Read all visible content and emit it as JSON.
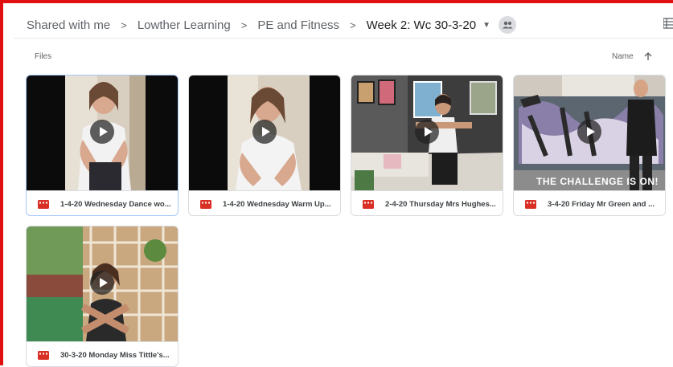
{
  "breadcrumb": {
    "items": [
      "Shared with me",
      "Lowther Learning",
      "PE and Fitness"
    ],
    "current": "Week 2: Wc 30-3-20"
  },
  "icons": {
    "separator": "chevron-right-icon",
    "dropdown": "caret-down-icon",
    "shared_folder": "people-icon",
    "view_toggle": "list-view-icon",
    "sort_direction": "arrow-up-icon",
    "video_file": "video-file-icon",
    "play": "play-icon"
  },
  "files_section": {
    "label": "Files",
    "sort_label": "Name"
  },
  "files": [
    {
      "name": "1-4-20 Wednesday Dance wo...",
      "selected": true
    },
    {
      "name": "1-4-20 Wednesday Warm Up..."
    },
    {
      "name": "2-4-20 Thursday Mrs Hughes..."
    },
    {
      "name": "3-4-20 Friday Mr Green and ...",
      "overlay_text": "THE CHALLENGE IS ON!"
    },
    {
      "name": "30-3-20 Monday Miss Tittle's..."
    }
  ],
  "colors": {
    "frame": "#e01010",
    "video_icon": "#d93025",
    "text": "#5f6368"
  }
}
